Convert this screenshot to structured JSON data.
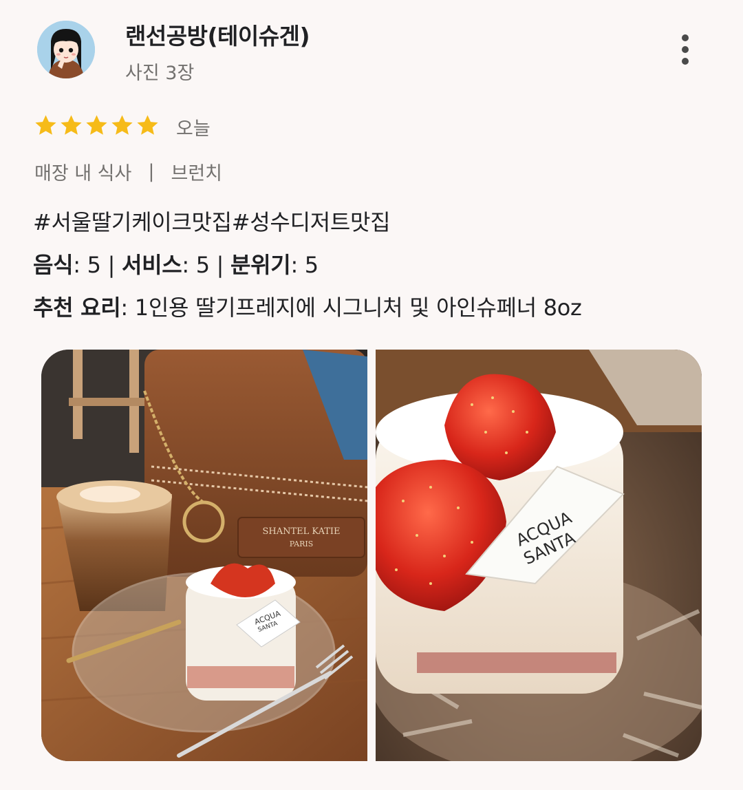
{
  "reviewer": {
    "name": "랜선공방(테이슈겐)",
    "photo_count": "사진 3장"
  },
  "rating": {
    "stars": 5,
    "date": "오늘"
  },
  "meta": {
    "dining": "매장 내 식사",
    "separator": "|",
    "meal": "브런치"
  },
  "review": {
    "hashtags": "#서울딸기케이크맛집#성수디저트맛집",
    "scores": [
      {
        "label": "음식",
        "value": "5"
      },
      {
        "label": "서비스",
        "value": "5"
      },
      {
        "label": "분위기",
        "value": "5"
      }
    ],
    "recommend_label": "추천 요리",
    "recommend_text": "1인용 딸기프레지에 시그니처 및 아인슈페너 8oz"
  },
  "photos": {
    "bag_tag_line1": "SHANTEL KATIE",
    "bag_tag_line2": "PARIS",
    "cake_tag_line1": "ACQUA",
    "cake_tag_line2": "SANTA"
  },
  "colors": {
    "star": "#f6bb19",
    "background": "#fbf7f6"
  },
  "icons": [
    "more-vert-icon",
    "star-icon"
  ]
}
